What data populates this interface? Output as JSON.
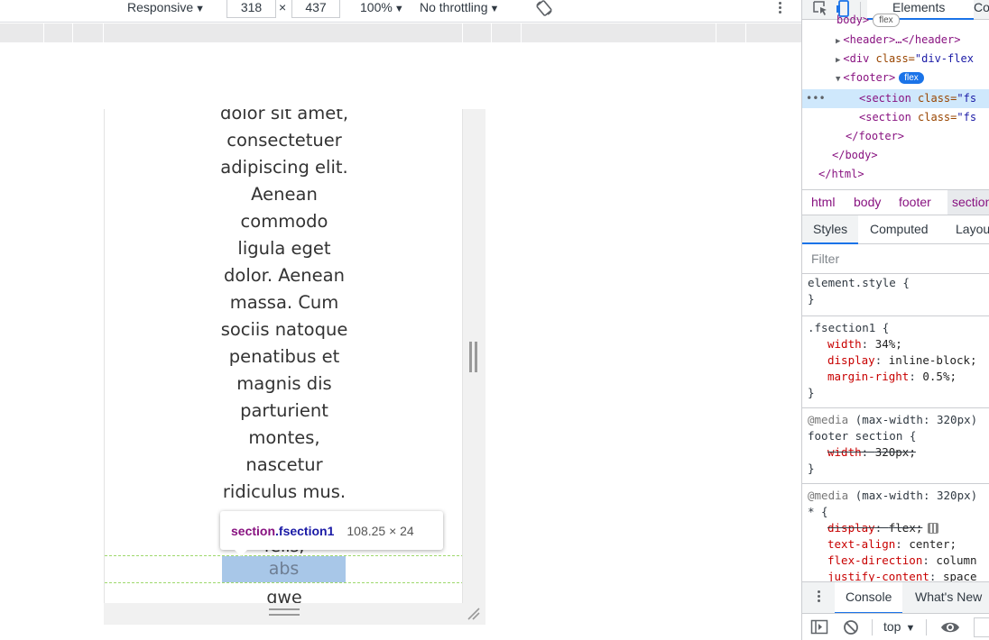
{
  "toolbar": {
    "device_mode": "Responsive",
    "width": "318",
    "times": "×",
    "height": "437",
    "zoom": "100%",
    "throttling": "No throttling"
  },
  "page": {
    "paragraph_lines": [
      "dolor sit amet,",
      "consectetuer",
      "adipiscing elit.",
      "Aenean",
      "commodo",
      "ligula eget",
      "dolor. Aenean",
      "massa. Cum",
      "sociis natoque",
      "penatibus et",
      "magnis dis",
      "parturient",
      "montes,",
      "nascetur",
      "ridiculus mus."
    ],
    "partial_line": "felis,",
    "highlight_text": "abs",
    "next_text": "qwe"
  },
  "tooltip": {
    "tag": "section",
    "class": ".fsection1",
    "size": "108.25 × 24"
  },
  "devtools": {
    "tab_elements": "Elements",
    "tab_console_partial": "Co",
    "dom": {
      "body_line": "body>",
      "body_badge": "flex",
      "header_line": "<header>…</header>",
      "div_tag": "<div ",
      "div_attr": "class=",
      "div_val": "\"div-flex",
      "footer_line": "<footer>",
      "footer_badge": "flex",
      "section1_tag": "<section ",
      "section1_attr": "class=",
      "section1_val": "\"fs",
      "section2_tag": "<section ",
      "section2_attr": "class=",
      "section2_val": "\"fs",
      "footer_close": "</footer>",
      "body_close": "</body>",
      "html_close": "</html>"
    },
    "breadcrumbs": [
      "html",
      "body",
      "footer",
      "section"
    ],
    "sub_tabs": {
      "styles": "Styles",
      "computed": "Computed",
      "layout": "Layou"
    },
    "filter_placeholder": "Filter",
    "rules": {
      "element_style": "element.style {",
      "close": "}",
      "fsection_selector": ".fsection1 {",
      "width_prop": "width",
      "width_val": "34%;",
      "display_prop": "display",
      "display_val": "inline-block;",
      "margin_prop": "margin-right",
      "margin_val": "0.5%;",
      "media1": "@media",
      "media1_cond": "(max-width: 320px)",
      "footer_selector": "footer section {",
      "fwidth_prop": "width",
      "fwidth_val": "320px;",
      "media2": "@media",
      "media2_cond": "(max-width: 320px)",
      "star_selector": "* {",
      "sdisplay_prop": "display",
      "sdisplay_val": "flex;",
      "talign_prop": "text-align",
      "talign_val": "center;",
      "fdir_prop": "flex-direction",
      "fdir_val": "column",
      "jc_prop": "justify-content",
      "jc_val": "space"
    },
    "drawer": {
      "console": "Console",
      "whats_new": "What's New"
    },
    "console_bar": {
      "context": "top"
    }
  }
}
